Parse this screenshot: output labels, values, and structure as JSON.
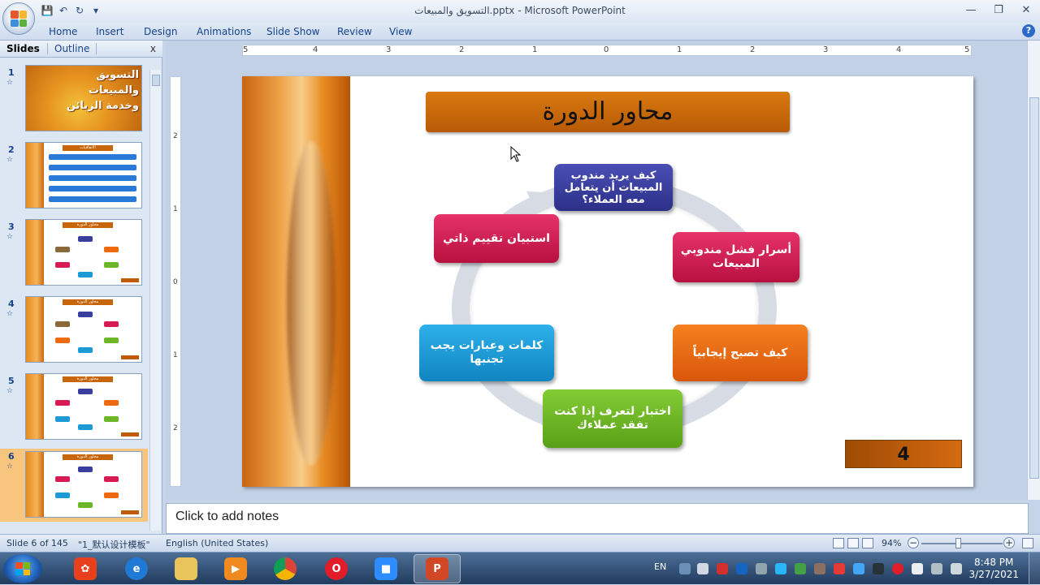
{
  "window": {
    "title": "التسويق والمبيعات.pptx - Microsoft PowerPoint",
    "minimize": "—",
    "maximize": "❐",
    "close": "✕"
  },
  "ribbon": {
    "tabs": [
      "Home",
      "Insert",
      "Design",
      "Animations",
      "Slide Show",
      "Review",
      "View"
    ]
  },
  "left_pane": {
    "tabs": [
      "Slides",
      "Outline"
    ],
    "close": "x",
    "thumbs": [
      {
        "num": "1",
        "title": "التسويق والمبيعات وخدمة الزبائن"
      },
      {
        "num": "2",
        "caption": "الاتفاقيات"
      },
      {
        "num": "3",
        "caption": "محاور الدورة"
      },
      {
        "num": "4",
        "caption": "محاور الدورة"
      },
      {
        "num": "5",
        "caption": "محاور الدورة"
      },
      {
        "num": "6",
        "caption": "محاور الدورة"
      }
    ]
  },
  "ruler": {
    "h_labels": [
      "5",
      "4",
      "3",
      "2",
      "1",
      "0",
      "1",
      "2",
      "3",
      "4",
      "5"
    ],
    "v_labels": [
      "2",
      "1",
      "0",
      "1",
      "2"
    ]
  },
  "slide": {
    "title": "محاور الدورة",
    "number": "4",
    "nodes": [
      {
        "text": "كيف يريد مندوب المبيعات أن يتعامل معه العملاء؟",
        "color": "#3a3f9e"
      },
      {
        "text": "أسرار فشل مندوبي المبيعات",
        "color": "#d81b52"
      },
      {
        "text": "كيف تصبح إيجابياً",
        "color": "#ee6a10"
      },
      {
        "text": "اختبار لتعرف إذا كنت تفقد عملاءك",
        "color": "#6cb628"
      },
      {
        "text": "كلمات وعبارات يجب تجنبها",
        "color": "#1c9ad6"
      },
      {
        "text": "استبيان تقييم ذاتي",
        "color": "#d81b52"
      }
    ]
  },
  "notes": {
    "placeholder": "Click to add notes"
  },
  "status": {
    "slide": "Slide 6 of 145",
    "theme": "\"1_默认设计模板\"",
    "language": "English (United States)",
    "zoom": "94%"
  },
  "taskbar": {
    "lang": "EN",
    "time": "8:48 PM",
    "date": "3/27/2021",
    "apps": [
      "paint-app",
      "internet-explorer",
      "file-explorer",
      "media-player",
      "chrome",
      "opera",
      "zoom",
      "powerpoint"
    ]
  },
  "colors": {
    "accent": "#c86509",
    "ribbon": "#dfe9f5"
  }
}
